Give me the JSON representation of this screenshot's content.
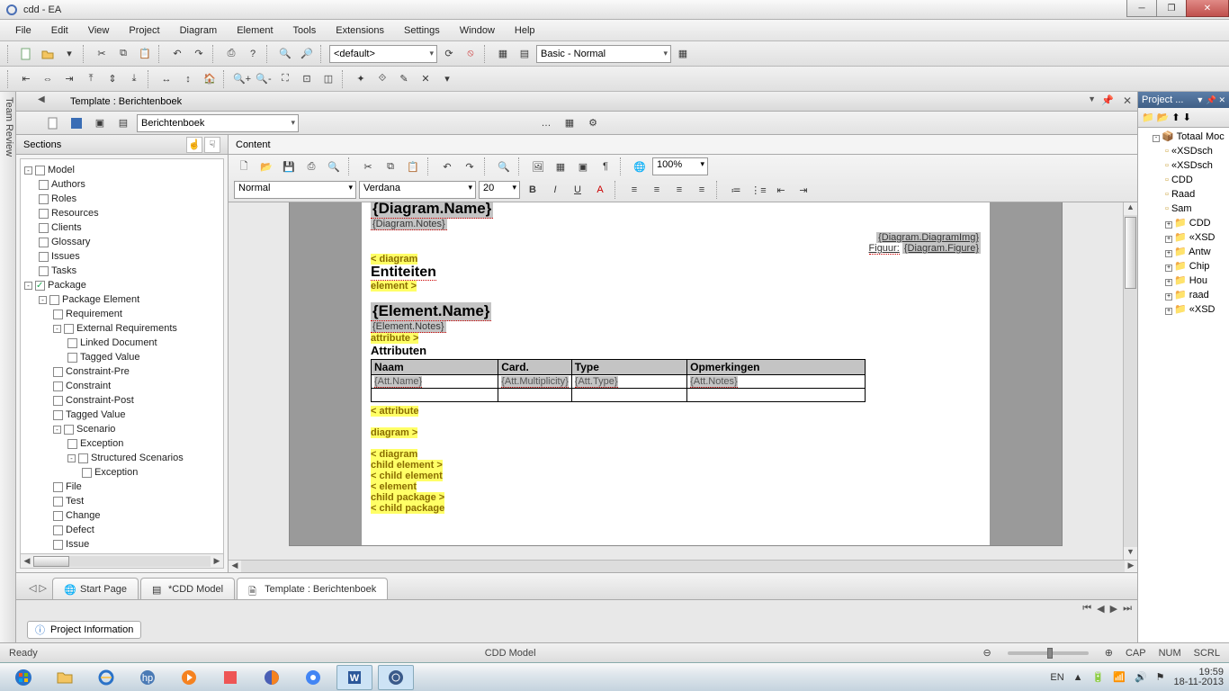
{
  "titlebar": {
    "title": "cdd - EA"
  },
  "menus": [
    "File",
    "Edit",
    "View",
    "Project",
    "Diagram",
    "Element",
    "Tools",
    "Extensions",
    "Settings",
    "Window",
    "Help"
  ],
  "toolbar1": {
    "combo_default": "<default>",
    "combo_basic": "Basic - Normal"
  },
  "template": {
    "header": "Template : Berichtenboek",
    "name_combo": "Berichtenboek",
    "sections_label": "Sections",
    "content_label": "Content"
  },
  "tree": [
    {
      "label": "Model",
      "tog": "-",
      "children": [
        {
          "label": "Authors"
        },
        {
          "label": "Roles"
        },
        {
          "label": "Resources"
        },
        {
          "label": "Clients"
        },
        {
          "label": "Glossary"
        },
        {
          "label": "Issues"
        },
        {
          "label": "Tasks"
        }
      ]
    },
    {
      "label": "Package",
      "tog": "-",
      "checked": true,
      "children": [
        {
          "label": "Package Element",
          "tog": "-",
          "children": [
            {
              "label": "Requirement"
            },
            {
              "label": "External Requirements",
              "tog": "-",
              "children": [
                {
                  "label": "Linked Document"
                },
                {
                  "label": "Tagged Value"
                }
              ]
            },
            {
              "label": "Constraint-Pre"
            },
            {
              "label": "Constraint"
            },
            {
              "label": "Constraint-Post"
            },
            {
              "label": "Tagged Value"
            },
            {
              "label": "Scenario",
              "tog": "-",
              "children": [
                {
                  "label": "Exception"
                },
                {
                  "label": "Structured Scenarios",
                  "tog": "-",
                  "children": [
                    {
                      "label": "Exception"
                    }
                  ]
                }
              ]
            },
            {
              "label": "File"
            },
            {
              "label": "Test"
            },
            {
              "label": "Change"
            },
            {
              "label": "Defect"
            },
            {
              "label": "Issue"
            }
          ]
        }
      ]
    }
  ],
  "editor": {
    "style_combo": "Normal",
    "font_combo": "Verdana",
    "size_combo": "20",
    "zoom": "100%",
    "diagram_name": "{Diagram.Name}",
    "diagram_notes": "{Diagram.Notes}",
    "diagram_img": "{Diagram.DiagramImg}",
    "figuur": "Figuur:",
    "diagram_figure": "{Diagram.Figure}",
    "lt_diagram": "< diagram",
    "entiteiten": "Entiteiten",
    "element_gt": "element >",
    "element_name": "{Element.Name}",
    "element_notes": "{Element.Notes}",
    "attribute_gt": "attribute >",
    "attributen": "Attributen",
    "th_naam": "Naam",
    "th_card": "Card.",
    "th_type": "Type",
    "th_opm": "Opmerkingen",
    "att_name": "{Att.Name}",
    "att_mul": "{Att.Multiplicity}",
    "att_type": "{Att.Type}",
    "att_notes": "{Att.Notes}",
    "lt_attribute": "< attribute",
    "diagram_gt": "diagram >",
    "lines": [
      "< diagram",
      "child element >",
      "< child element",
      "< element",
      "child package >",
      "< child package"
    ]
  },
  "tabs": {
    "start": "Start Page",
    "cdd": "*CDD Model",
    "template": "Template : Berichtenboek"
  },
  "proj_info": "Project Information",
  "status": {
    "ready": "Ready",
    "model": "CDD Model",
    "cap": "CAP",
    "num": "NUM",
    "scrl": "SCRL"
  },
  "right_panel": {
    "title": "Project ...",
    "root": "Totaal Moc",
    "items": [
      "«XSDsch",
      "«XSDsch",
      "CDD",
      "Raad",
      "Sam",
      "CDD",
      "«XSD",
      "Antw",
      "Chip",
      "Hou",
      "raad",
      "«XSD"
    ]
  },
  "tray": {
    "lang": "EN",
    "time": "19:59",
    "date": "18-11-2013"
  }
}
